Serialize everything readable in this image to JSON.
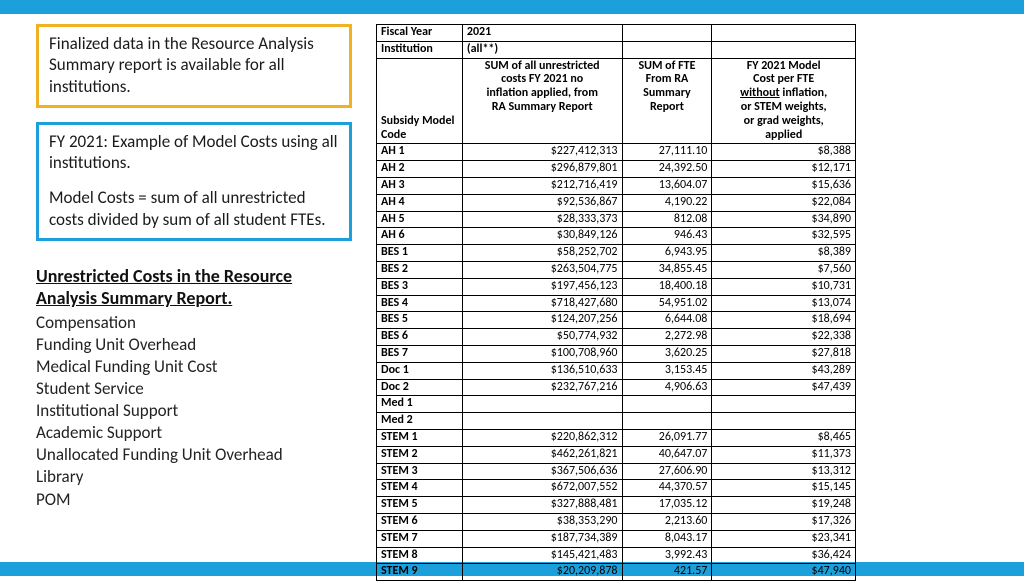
{
  "box1_text": "Finalized data in the Resource Analysis Summary report is available for all institutions.",
  "box2_para1": "FY 2021: Example of Model Costs using all institutions.",
  "box2_para2": "Model Costs = sum of all unrestricted costs divided by sum of all student FTEs.",
  "heading": "Unrestricted Costs in the Resource Analysis Summary Report.",
  "items": [
    "Compensation",
    "Funding Unit Overhead",
    "Medical Funding Unit Cost",
    "Student Service",
    "Institutional Support",
    "Academic Support",
    "Unallocated Funding Unit Overhead",
    "Library",
    "POM"
  ],
  "meta": {
    "fy_label": "Fiscal Year",
    "fy_value": "2021",
    "inst_label": "Institution",
    "inst_value": "(all**)"
  },
  "headers": {
    "code": "Subsidy Model Code",
    "col2_line1": "SUM of all unrestricted",
    "col2_line2": "costs FY 2021 no",
    "col2_line3": "inflation applied, from",
    "col2_line4": "RA Summary Report",
    "col3_line1": "SUM of FTE",
    "col3_line2": "From RA",
    "col3_line3": "Summary",
    "col3_line4": "Report",
    "col4_line1": "FY 2021 Model",
    "col4_line2": "Cost per FTE",
    "col4_line3a": "without",
    "col4_line3b": " inflation,",
    "col4_line4": "or STEM weights,",
    "col4_line5": "or grad weights,",
    "col4_line6": "applied"
  },
  "rows": [
    {
      "code": "AH 1",
      "cost": "$227,412,313",
      "fte": "27,111.10",
      "model": "$8,388"
    },
    {
      "code": "AH 2",
      "cost": "$296,879,801",
      "fte": "24,392.50",
      "model": "$12,171"
    },
    {
      "code": "AH 3",
      "cost": "$212,716,419",
      "fte": "13,604.07",
      "model": "$15,636"
    },
    {
      "code": "AH 4",
      "cost": "$92,536,867",
      "fte": "4,190.22",
      "model": "$22,084"
    },
    {
      "code": "AH 5",
      "cost": "$28,333,373",
      "fte": "812.08",
      "model": "$34,890"
    },
    {
      "code": "AH 6",
      "cost": "$30,849,126",
      "fte": "946.43",
      "model": "$32,595"
    },
    {
      "code": "BES 1",
      "cost": "$58,252,702",
      "fte": "6,943.95",
      "model": "$8,389"
    },
    {
      "code": "BES 2",
      "cost": "$263,504,775",
      "fte": "34,855.45",
      "model": "$7,560"
    },
    {
      "code": "BES 3",
      "cost": "$197,456,123",
      "fte": "18,400.18",
      "model": "$10,731"
    },
    {
      "code": "BES 4",
      "cost": "$718,427,680",
      "fte": "54,951.02",
      "model": "$13,074"
    },
    {
      "code": "BES 5",
      "cost": "$124,207,256",
      "fte": "6,644.08",
      "model": "$18,694"
    },
    {
      "code": "BES 6",
      "cost": "$50,774,932",
      "fte": "2,272.98",
      "model": "$22,338"
    },
    {
      "code": "BES 7",
      "cost": "$100,708,960",
      "fte": "3,620.25",
      "model": "$27,818"
    },
    {
      "code": "Doc 1",
      "cost": "$136,510,633",
      "fte": "3,153.45",
      "model": "$43,289"
    },
    {
      "code": "Doc 2",
      "cost": "$232,767,216",
      "fte": "4,906.63",
      "model": "$47,439"
    },
    {
      "code": "Med 1",
      "cost": "",
      "fte": "",
      "model": ""
    },
    {
      "code": "Med 2",
      "cost": "",
      "fte": "",
      "model": ""
    },
    {
      "code": "STEM 1",
      "cost": "$220,862,312",
      "fte": "26,091.77",
      "model": "$8,465"
    },
    {
      "code": "STEM 2",
      "cost": "$462,261,821",
      "fte": "40,647.07",
      "model": "$11,373"
    },
    {
      "code": "STEM 3",
      "cost": "$367,506,636",
      "fte": "27,606.90",
      "model": "$13,312"
    },
    {
      "code": "STEM 4",
      "cost": "$672,007,552",
      "fte": "44,370.57",
      "model": "$15,145"
    },
    {
      "code": "STEM 5",
      "cost": "$327,888,481",
      "fte": "17,035.12",
      "model": "$19,248"
    },
    {
      "code": "STEM 6",
      "cost": "$38,353,290",
      "fte": "2,213.60",
      "model": "$17,326"
    },
    {
      "code": "STEM 7",
      "cost": "$187,734,389",
      "fte": "8,043.17",
      "model": "$23,341"
    },
    {
      "code": "STEM 8",
      "cost": "$145,421,483",
      "fte": "3,992.43",
      "model": "$36,424"
    },
    {
      "code": "STEM 9",
      "cost": "$20,209,878",
      "fte": "421.57",
      "model": "$47,940"
    }
  ]
}
